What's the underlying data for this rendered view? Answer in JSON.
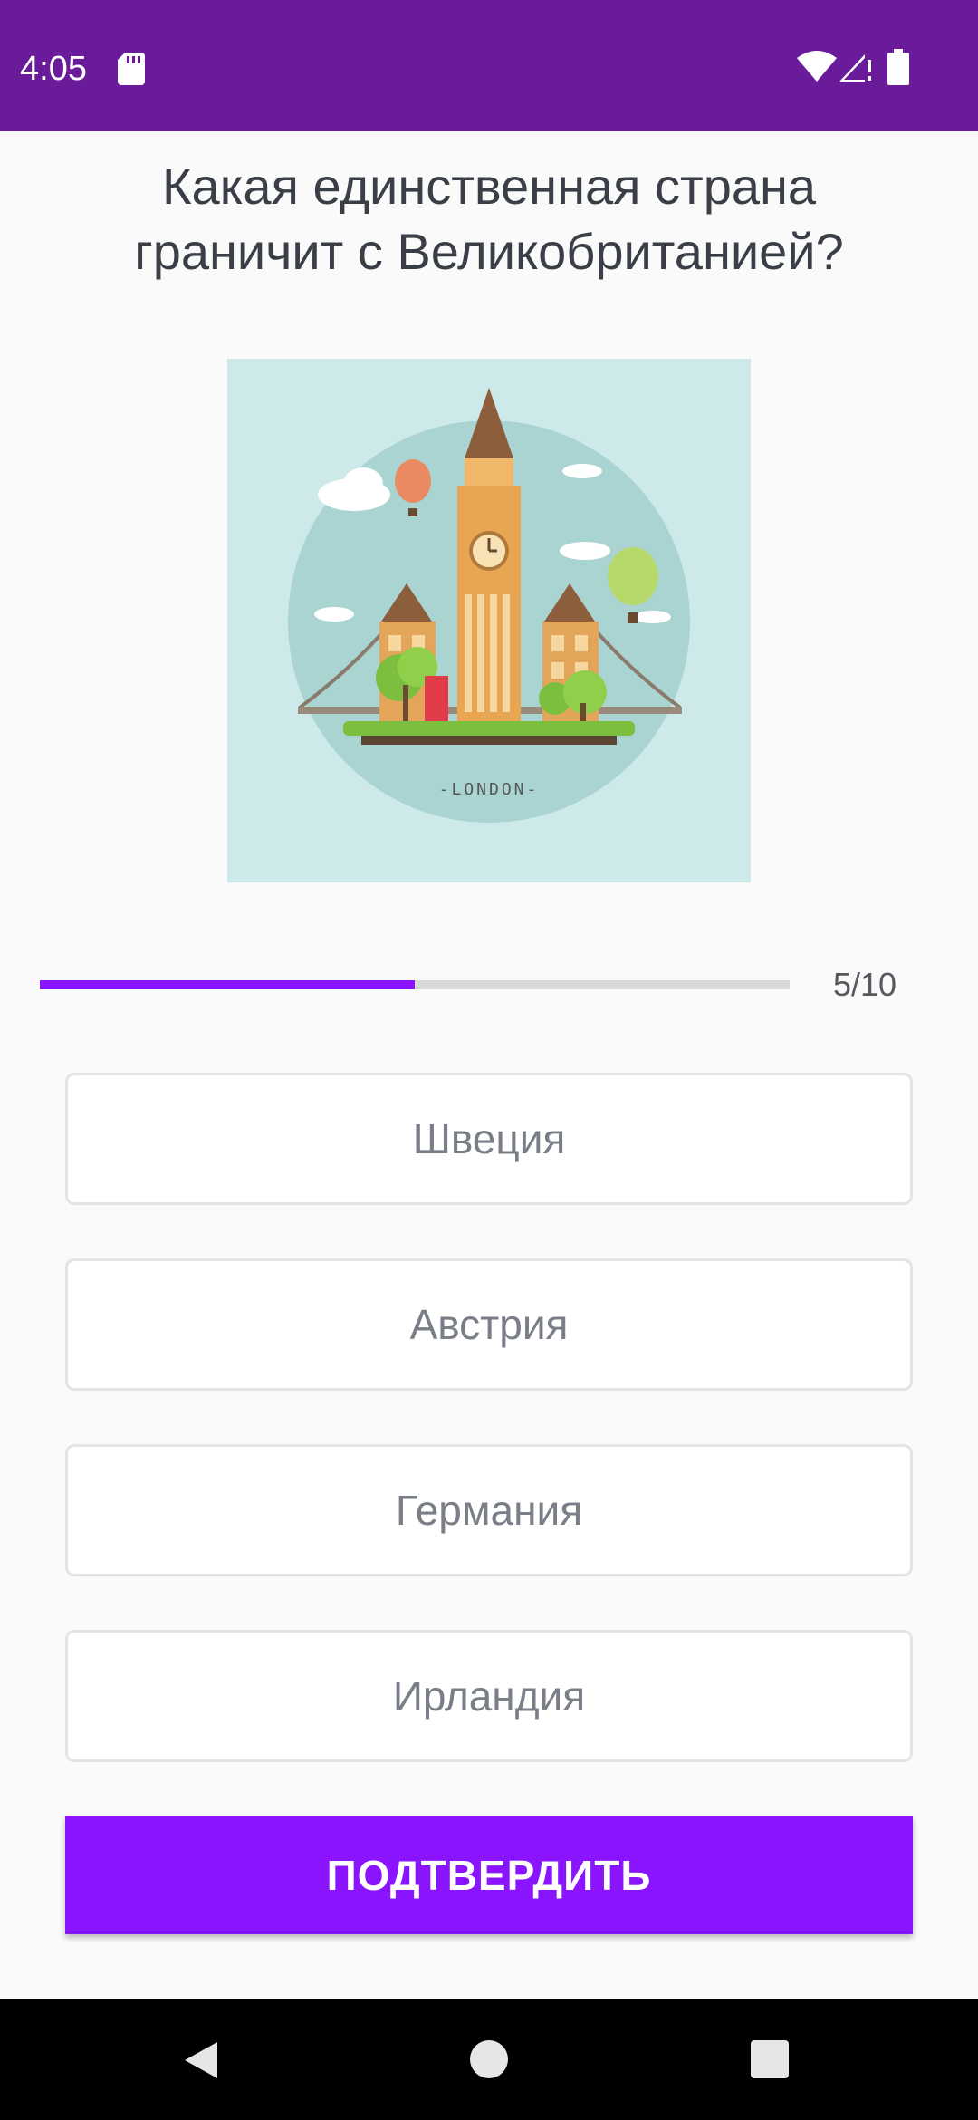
{
  "status_bar": {
    "time": "4:05",
    "icons": [
      "sd-card-icon",
      "wifi-icon",
      "signal-icon",
      "battery-icon"
    ],
    "background": "#6a1b9a"
  },
  "quiz": {
    "question": "Какая единственная страна граничит с Великобританией?",
    "image_caption": "-LONDON-",
    "progress": {
      "current": 5,
      "total": 10,
      "label": "5/10",
      "fraction": 0.5
    },
    "options": [
      {
        "label": "Швеция"
      },
      {
        "label": "Австрия"
      },
      {
        "label": "Германия"
      },
      {
        "label": "Ирландия"
      }
    ],
    "confirm_label": "ПОДТВЕРДИТЬ"
  },
  "colors": {
    "accent": "#8a14fd",
    "status_bar": "#6a1b9a"
  },
  "navigation_bar": {
    "icons": [
      "back-icon",
      "home-icon",
      "recents-icon"
    ]
  }
}
